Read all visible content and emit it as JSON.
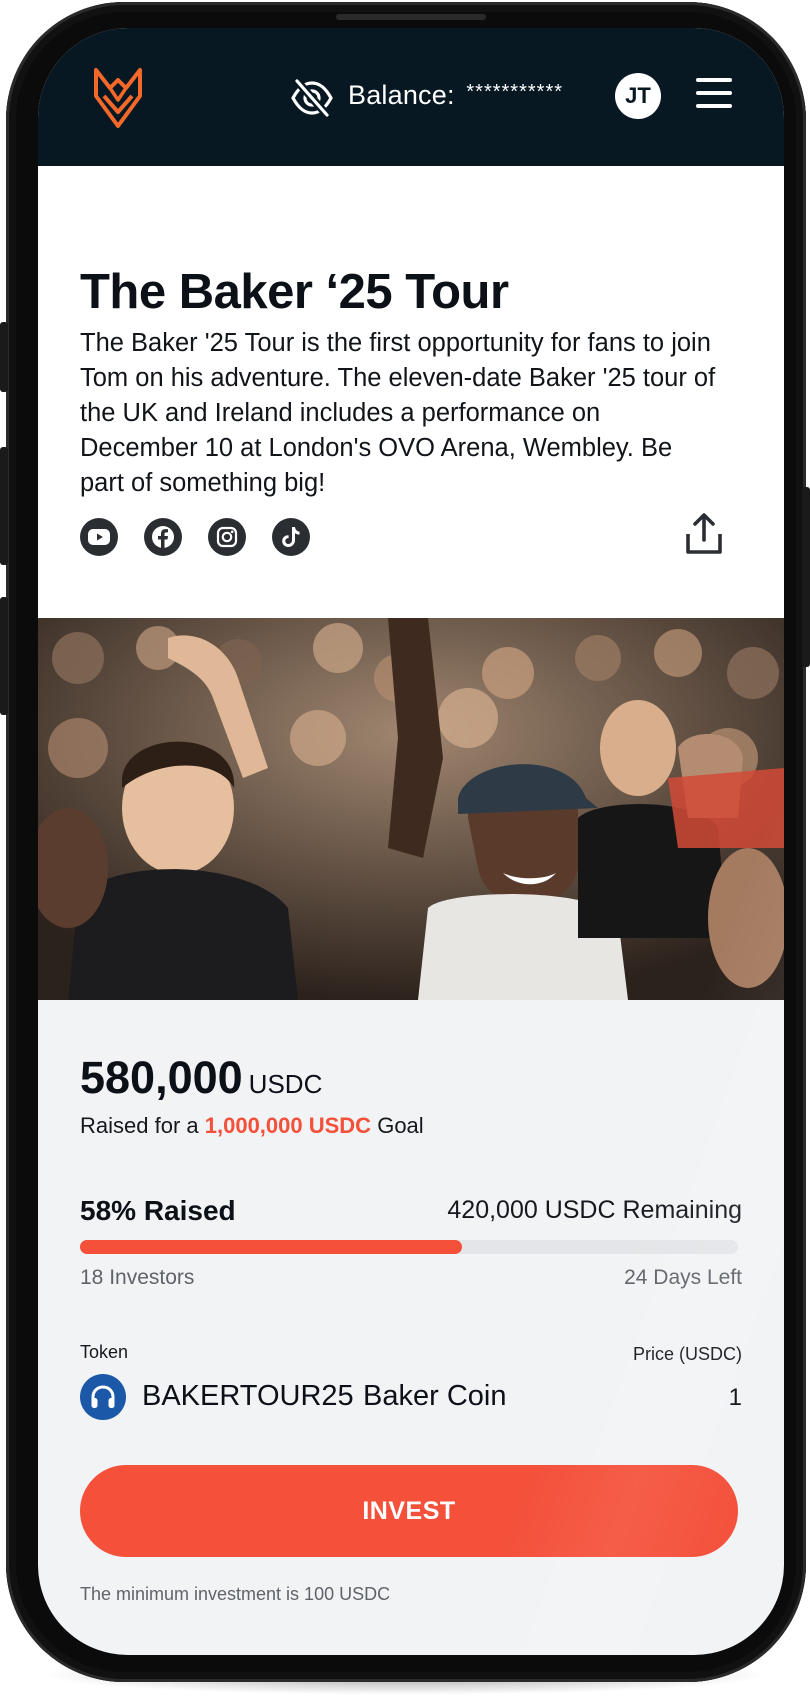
{
  "header": {
    "balance_label": "Balance:",
    "balance_value": "***********",
    "avatar_initials": "JT"
  },
  "campaign": {
    "title": "The Baker ‘25 Tour",
    "description": "The Baker '25 Tour is the first opportunity for fans to join Tom on his adventure. The eleven-date Baker '25 tour of the UK and Ireland includes a performance on December 10 at London's OVO Arena, Wembley. Be part of something big!",
    "socials": [
      "youtube-icon",
      "facebook-icon",
      "instagram-icon",
      "tiktok-icon"
    ]
  },
  "funding": {
    "raised_amount": "580,000",
    "raised_unit": "USDC",
    "goal_prefix": "Raised for a",
    "goal_amount": "1,000,000 USDC",
    "goal_suffix": "Goal",
    "percent_label": "58% Raised",
    "percent_value": 58,
    "remaining": "420,000 USDC Remaining",
    "investors": "18 Investors",
    "days_left": "24 Days Left"
  },
  "token": {
    "label": "Token",
    "symbol": "BAKERTOUR25",
    "name": "Baker Coin",
    "price_label": "Price (USDC)",
    "price": "1"
  },
  "actions": {
    "invest_label": "INVEST",
    "min_note": "The minimum investment is 100 USDC"
  },
  "colors": {
    "accent": "#f4503a",
    "header_bg": "#081822",
    "token_blue": "#1b58a8"
  }
}
